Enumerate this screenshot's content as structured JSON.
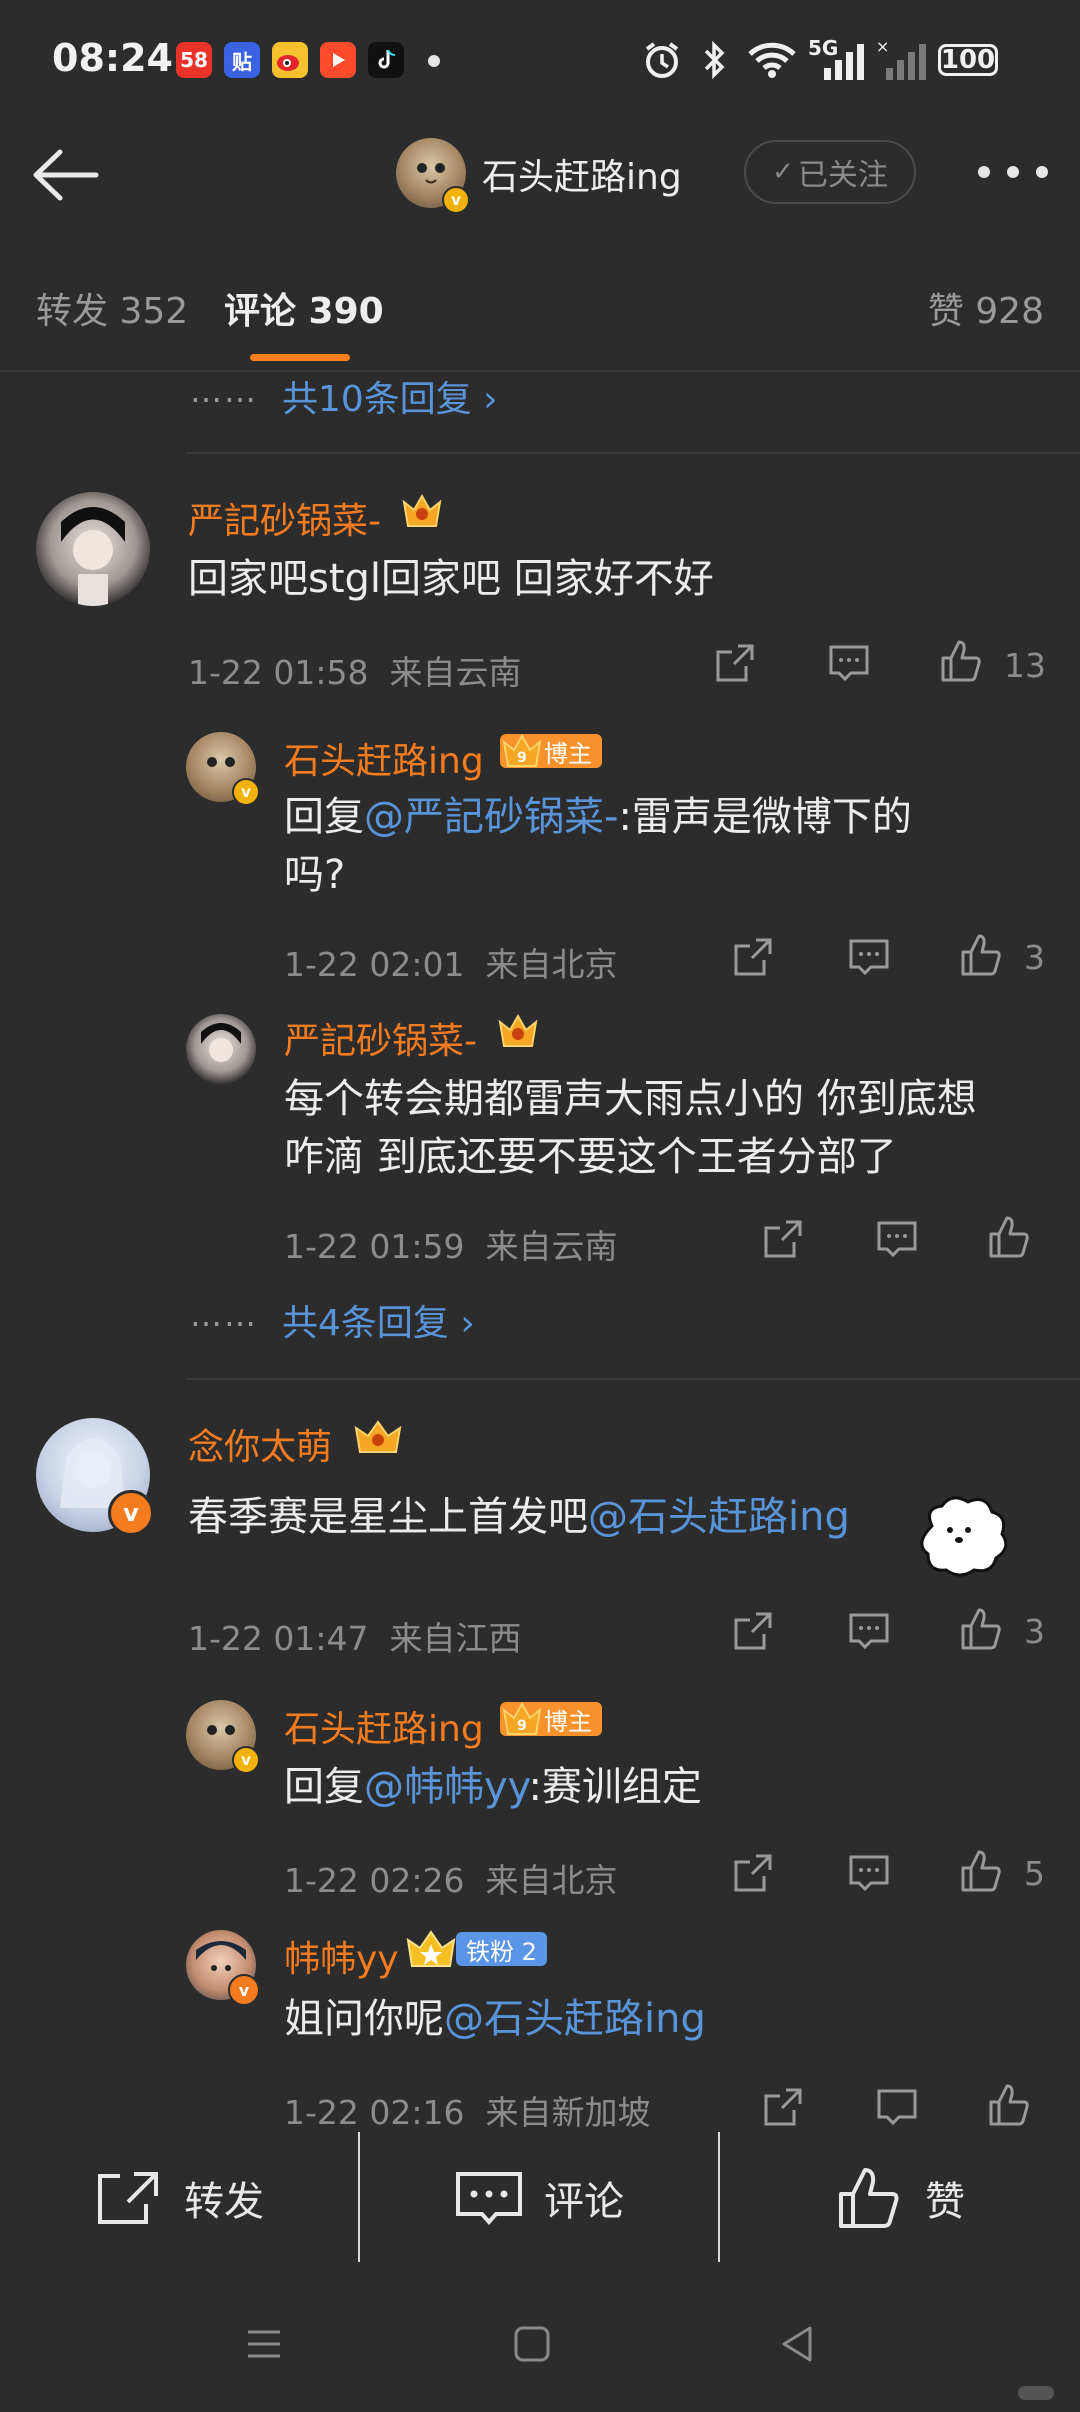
{
  "status_bar": {
    "time": "08:24",
    "apps": [
      {
        "icon": "58-app-icon",
        "text": "58",
        "color": "#e8332b"
      },
      {
        "icon": "tieba-app-icon",
        "text": "贴",
        "color": "#3b62e0"
      },
      {
        "icon": "weibo-app-icon",
        "text": "",
        "color": "#f6c12f"
      },
      {
        "icon": "video-app-icon",
        "text": "",
        "color": "#ff4b2b"
      },
      {
        "icon": "tiktok-app-icon",
        "text": "",
        "color": "#111111"
      }
    ],
    "network": "5G",
    "battery": "100"
  },
  "header": {
    "title": "石头赶路ing",
    "follow_label": "已关注"
  },
  "tabs": {
    "repost": "转发 352",
    "comment": "评论 390",
    "like": "赞 928"
  },
  "top_more_replies": "共10条回复",
  "threads": [
    {
      "user": "严記砂锅菜-",
      "text": "回家吧stgl回家吧 回家好不好",
      "time": "1-22 01:58",
      "location": "来自云南",
      "likes": "13",
      "replies": [
        {
          "user": "石头赶路ing",
          "badge": "博主",
          "reply_prefix": "回复",
          "mention": "@严記砂锅菜-",
          "text_line1": ":雷声是微博下的",
          "text_line2": "吗?",
          "time": "1-22 02:01",
          "location": "来自北京",
          "likes": "3"
        },
        {
          "user": "严記砂锅菜-",
          "text_line1": "每个转会期都雷声大雨点小的 你到底想",
          "text_line2": "咋滴 到底还要不要这个王者分部了",
          "time": "1-22 01:59",
          "location": "来自云南",
          "likes": ""
        }
      ],
      "more_replies": "共4条回复"
    },
    {
      "user": "念你太萌",
      "text": "春季赛是星尘上首发吧",
      "mention": "@石头赶路ing",
      "time": "1-22 01:47",
      "location": "来自江西",
      "likes": "3",
      "replies": [
        {
          "user": "石头赶路ing",
          "badge": "博主",
          "reply_prefix": "回复",
          "mention": "@帏帏yy",
          "text": ":赛训组定",
          "time": "1-22 02:26",
          "location": "来自北京",
          "likes": "5"
        },
        {
          "user": "帏帏yy",
          "badge": "铁粉 2",
          "text": "姐问你呢",
          "mention": "@石头赶路ing",
          "time": "1-22 02:16",
          "location": "来自新加坡"
        }
      ]
    }
  ],
  "bottom_bar": {
    "repost": "转发",
    "comment": "评论",
    "like": "赞"
  },
  "colors": {
    "background": "#2c2c2c",
    "username": "#f57b1f",
    "link": "#5a94d8",
    "meta": "#8c8c8c",
    "accent": "#ff7d1d"
  }
}
